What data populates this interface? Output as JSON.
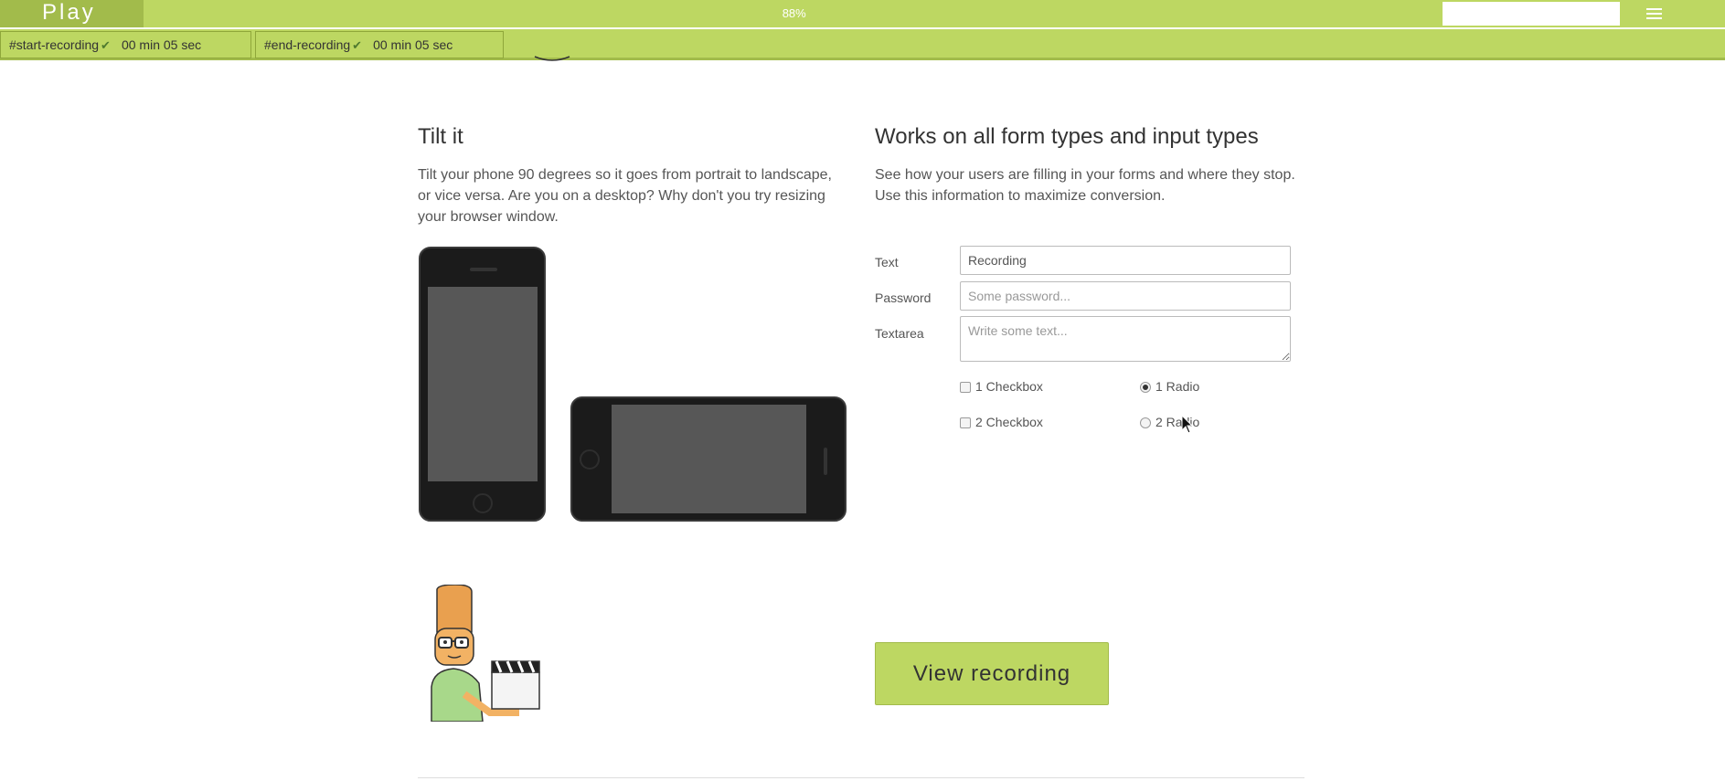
{
  "player": {
    "play_label": "Play",
    "progress_label": "88%",
    "progress_fraction": 0.88,
    "menu_icon": "hamburger-menu-icon",
    "accent_color": "#bdd762",
    "accent_dark": "#a2bb4b"
  },
  "markers": [
    {
      "name": "#start-recording",
      "check": "✔",
      "time": "00 min 05 sec"
    },
    {
      "name": "#end-recording",
      "check": "✔",
      "time": "00 min 05 sec"
    }
  ],
  "tilt": {
    "title": "Tilt it",
    "text": "Tilt your phone 90 degrees so it goes from portrait to landscape, or vice versa. Are you on a desktop? Why don't you try resizing your browser window."
  },
  "forms": {
    "title": "Works on all form types and input types",
    "text": "See how your users are filling in your forms and where they stop. Use this information to maximize conversion.",
    "text_label": "Text",
    "text_value": "Recording",
    "password_label": "Password",
    "password_placeholder": "Some password...",
    "textarea_label": "Textarea",
    "textarea_placeholder": "Write some text...",
    "checkbox1": "1 Checkbox",
    "checkbox2": "2 Checkbox",
    "radio1": "1 Radio",
    "radio2": "2 Radio",
    "radio_selected": "1 Radio"
  },
  "cta": {
    "view_recording": "View recording"
  }
}
